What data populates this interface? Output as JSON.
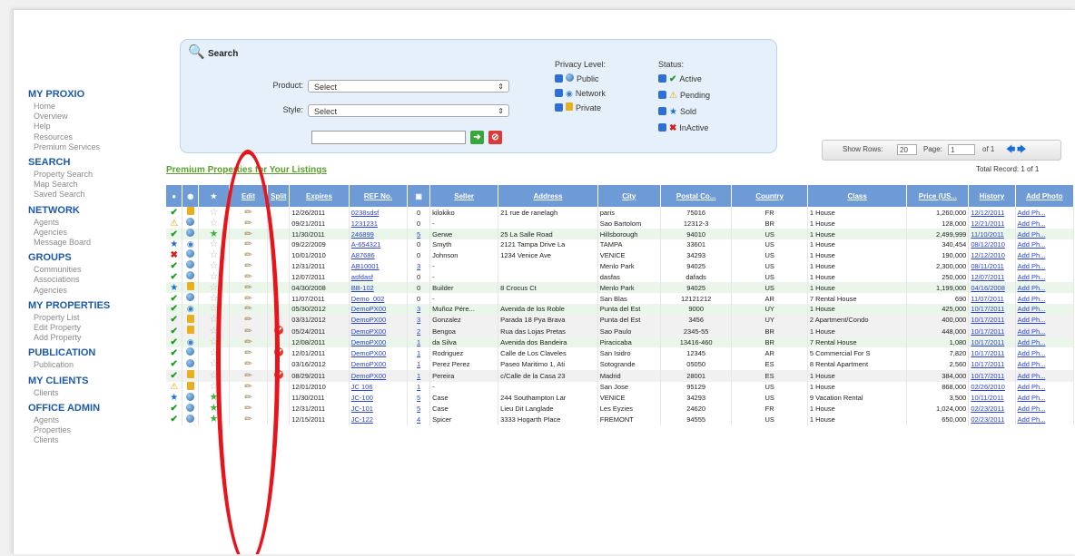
{
  "nav": [
    {
      "heading": "MY PROXIO",
      "items": [
        "Home",
        "Overview",
        "Help",
        "Resources",
        "Premium Services"
      ]
    },
    {
      "heading": "SEARCH",
      "items": [
        "Property Search",
        "Map Search",
        "Saved Search"
      ]
    },
    {
      "heading": "NETWORK",
      "items": [
        "Agents",
        "Agencies",
        "Message Board"
      ]
    },
    {
      "heading": "GROUPS",
      "items": [
        "Communities",
        "Associations",
        "Agencies"
      ]
    },
    {
      "heading": "MY PROPERTIES",
      "items": [
        "Property List",
        "Edit Property",
        "Add Property"
      ]
    },
    {
      "heading": "PUBLICATION",
      "items": [
        "Publication"
      ]
    },
    {
      "heading": "MY CLIENTS",
      "items": [
        "Clients"
      ]
    },
    {
      "heading": "OFFICE ADMIN",
      "items": [
        "Agents",
        "Properties",
        "Clients"
      ]
    }
  ],
  "search": {
    "title": "Search",
    "product_label": "Product:",
    "product_value": "Select",
    "style_label": "Style:",
    "style_value": "Select",
    "privacy_title": "Privacy Level:",
    "privacy": [
      {
        "label": "Public",
        "icon": "globe-icon"
      },
      {
        "label": "Network",
        "icon": "network-icon"
      },
      {
        "label": "Private",
        "icon": "lock-icon"
      }
    ],
    "status_title": "Status:",
    "status": [
      {
        "label": "Active",
        "icon": "check-icon"
      },
      {
        "label": "Pending",
        "icon": "warning-icon"
      },
      {
        "label": "Sold",
        "icon": "star-icon"
      },
      {
        "label": "InActive",
        "icon": "x-icon"
      }
    ]
  },
  "pager": {
    "show_rows_label": "Show Rows:",
    "rows_value": "20",
    "page_label": "Page:",
    "page_value": "1",
    "of_label": "of  1"
  },
  "premium_link": "Premium Properties for Your Listings",
  "total_record": "Total Record: 1 of 1",
  "columns": [
    "",
    "",
    "",
    "Edit",
    "Split",
    "Expires",
    "REF No.",
    "",
    "Seller",
    "Address",
    "City",
    "Postal Co...",
    "Country",
    "Class",
    "Price (US...",
    "History",
    "Add Photo"
  ],
  "rows": [
    {
      "status": "check",
      "privacy": "lock",
      "fav": false,
      "split": false,
      "expires": "12/26/2011",
      "ref": "0238sdsf",
      "photos": "0",
      "seller": "kilokiko",
      "address": "21 rue de ranelagh",
      "city": "paris",
      "postal": "75016",
      "country": "FR",
      "class": "1 House",
      "price": "1,260,000",
      "history": "12/12/2011",
      "add": "Add Ph..."
    },
    {
      "status": "warn",
      "privacy": "globe",
      "fav": false,
      "split": false,
      "expires": "09/21/2011",
      "ref": "1231231",
      "photos": "0",
      "seller": "-",
      "address": "",
      "city": "Sao Bartolom",
      "postal": "12312-3",
      "country": "BR",
      "class": "1 House",
      "price": "128,000",
      "history": "12/21/2011",
      "add": "Add Ph..."
    },
    {
      "status": "check",
      "privacy": "globe",
      "fav": true,
      "split": false,
      "expires": "11/30/2011",
      "ref": "246899",
      "photos": "5",
      "seller": "Gerwe",
      "address": "25 La Salle Road",
      "city": "Hillsborough",
      "postal": "94010",
      "country": "US",
      "class": "1 House",
      "price": "2,499,999",
      "history": "11/10/2011",
      "add": "Add Ph..."
    },
    {
      "status": "star",
      "privacy": "net",
      "fav": false,
      "split": false,
      "expires": "09/22/2009",
      "ref": "A-654321",
      "photos": "0",
      "seller": "Smyth",
      "address": "2121 Tampa Drive La",
      "city": "TAMPA",
      "postal": "33601",
      "country": "US",
      "class": "1 House",
      "price": "340,454",
      "history": "08/12/2010",
      "add": "Add Ph..."
    },
    {
      "status": "x",
      "privacy": "globe",
      "fav": false,
      "split": false,
      "expires": "10/01/2010",
      "ref": "A87686",
      "photos": "0",
      "seller": "Johnson",
      "address": "1234 Venice Ave",
      "city": "VENICE",
      "postal": "34293",
      "country": "US",
      "class": "1 House",
      "price": "190,000",
      "history": "12/12/2010",
      "add": "Add Ph..."
    },
    {
      "status": "check",
      "privacy": "globe",
      "fav": false,
      "split": false,
      "expires": "12/31/2011",
      "ref": "AB10001",
      "photos": "3",
      "seller": "-",
      "address": "",
      "city": "Menlo Park",
      "postal": "94025",
      "country": "US",
      "class": "1 House",
      "price": "2,300,000",
      "history": "08/11/2011",
      "add": "Add Ph..."
    },
    {
      "status": "check",
      "privacy": "globe",
      "fav": false,
      "split": false,
      "expires": "12/07/2011",
      "ref": "asfdasf",
      "photos": "0",
      "seller": "-",
      "address": "",
      "city": "dasfas",
      "postal": "dafads",
      "country": "US",
      "class": "1 House",
      "price": "250,000",
      "history": "12/07/2011",
      "add": "Add Ph..."
    },
    {
      "status": "star",
      "privacy": "lock",
      "fav": false,
      "split": false,
      "expires": "04/30/2008",
      "ref": "BB-102",
      "photos": "0",
      "seller": "Builder",
      "address": "8 Crocus Ct",
      "city": "Menlo Park",
      "postal": "94025",
      "country": "US",
      "class": "1 House",
      "price": "1,199,000",
      "history": "04/16/2008",
      "add": "Add Ph..."
    },
    {
      "status": "check",
      "privacy": "globe",
      "fav": false,
      "split": false,
      "expires": "11/07/2011",
      "ref": "Demo_002",
      "photos": "0",
      "seller": "-",
      "address": "",
      "city": "San Blas",
      "postal": "12121212",
      "country": "AR",
      "class": "7 Rental House",
      "price": "690",
      "history": "11/07/2011",
      "add": "Add Ph..."
    },
    {
      "status": "check",
      "privacy": "net",
      "fav": false,
      "split": false,
      "expires": "05/30/2012",
      "ref": "DemoPX00",
      "photos": "3",
      "seller": "Muñoz Pére...",
      "address": "Avenida de los Roble",
      "city": "Punta del Est",
      "postal": "9000",
      "country": "UY",
      "class": "1 House",
      "price": "425,000",
      "history": "10/17/2011",
      "add": "Add Ph..."
    },
    {
      "status": "check",
      "privacy": "lock",
      "fav": false,
      "split": false,
      "expires": "03/31/2012",
      "ref": "DemoPX00",
      "photos": "3",
      "seller": "Gonzalez",
      "address": "Parada 18 Pya Brava",
      "city": "Punta del Est",
      "postal": "3456",
      "country": "UY",
      "class": "2 Apartment/Condo",
      "price": "400,000",
      "history": "10/17/2011",
      "add": "Add Ph..."
    },
    {
      "status": "check",
      "privacy": "lock",
      "fav": false,
      "split": true,
      "expires": "05/24/2011",
      "ref": "DemoPX00",
      "photos": "2",
      "seller": "Bengoa",
      "address": "Rua das Lojas Pretas",
      "city": "Sao Paulo",
      "postal": "2345-55",
      "country": "BR",
      "class": "1 House",
      "price": "448,000",
      "history": "10/17/2011",
      "add": "Add Ph..."
    },
    {
      "status": "check",
      "privacy": "net",
      "fav": false,
      "split": false,
      "expires": "12/08/2011",
      "ref": "DemoPX00",
      "photos": "1",
      "seller": "da Silva",
      "address": "Avenida dos Bandeira",
      "city": "Piracicaba",
      "postal": "13416-460",
      "country": "BR",
      "class": "7 Rental House",
      "price": "1,080",
      "history": "10/17/2011",
      "add": "Add Ph..."
    },
    {
      "status": "check",
      "privacy": "globe",
      "fav": false,
      "split": true,
      "expires": "12/01/2011",
      "ref": "DemoPX00",
      "photos": "1",
      "seller": "Rodriguez",
      "address": "Calle de Los Claveles",
      "city": "San Isidro",
      "postal": "12345",
      "country": "AR",
      "class": "5 Commercial For S",
      "price": "7,820",
      "history": "10/17/2011",
      "add": "Add Ph..."
    },
    {
      "status": "check",
      "privacy": "globe",
      "fav": false,
      "split": false,
      "expires": "03/16/2012",
      "ref": "DemoPX00",
      "photos": "1",
      "seller": "Perez Perez",
      "address": "Paseo Maritimo 1, Ati",
      "city": "Sotogrande",
      "postal": "05050",
      "country": "ES",
      "class": "8 Rental Apartment",
      "price": "2,560",
      "history": "10/17/2011",
      "add": "Add Ph..."
    },
    {
      "status": "check",
      "privacy": "lock",
      "fav": false,
      "split": true,
      "expires": "08/29/2011",
      "ref": "DemoPX00",
      "photos": "1",
      "seller": "Pereira",
      "address": "c/Calle de la Casa 23",
      "city": "Madrid",
      "postal": "28001",
      "country": "ES",
      "class": "1 House",
      "price": "384,000",
      "history": "10/17/2011",
      "add": "Add Ph..."
    },
    {
      "status": "warn",
      "privacy": "lock",
      "fav": false,
      "split": false,
      "expires": "12/01/2010",
      "ref": "JC 106",
      "photos": "1",
      "seller": "-",
      "address": "",
      "city": "San Jose",
      "postal": "95129",
      "country": "US",
      "class": "1 House",
      "price": "868,000",
      "history": "02/26/2010",
      "add": "Add Ph..."
    },
    {
      "status": "star",
      "privacy": "globe",
      "fav": true,
      "split": false,
      "expires": "11/30/2011",
      "ref": "JC-100",
      "photos": "5",
      "seller": "Case",
      "address": "244 Southampton Lar",
      "city": "VENICE",
      "postal": "34293",
      "country": "US",
      "class": "9 Vacation Rental",
      "price": "3,500",
      "history": "10/11/2011",
      "add": "Add Ph..."
    },
    {
      "status": "check",
      "privacy": "globe",
      "fav": true,
      "split": false,
      "expires": "12/31/2011",
      "ref": "JC-101",
      "photos": "5",
      "seller": "Case",
      "address": "Lieu Dit Langlade",
      "city": "Les Eyzies",
      "postal": "24620",
      "country": "FR",
      "class": "1 House",
      "price": "1,024,000",
      "history": "02/23/2011",
      "add": "Add Ph..."
    },
    {
      "status": "check",
      "privacy": "globe",
      "fav": true,
      "split": false,
      "expires": "12/15/2011",
      "ref": "JC-122",
      "photos": "4",
      "seller": "Spicer",
      "address": "3333 Hogarth Place",
      "city": "FREMONT",
      "postal": "94555",
      "country": "US",
      "class": "1 House",
      "price": "650,000",
      "history": "02/23/2011",
      "add": "Add Ph..."
    }
  ],
  "row_shades": [
    "r0",
    "r0",
    "r1",
    "r0",
    "r0",
    "r0",
    "r0",
    "r1",
    "r0",
    "r1",
    "r2",
    "r2",
    "r1",
    "r0",
    "r0",
    "r2",
    "r0",
    "r0",
    "r0",
    "r0"
  ],
  "colors": {
    "accent": "#1e5aa8",
    "header": "#6e9bd6",
    "highlight_ellipse": "#e8141c"
  }
}
